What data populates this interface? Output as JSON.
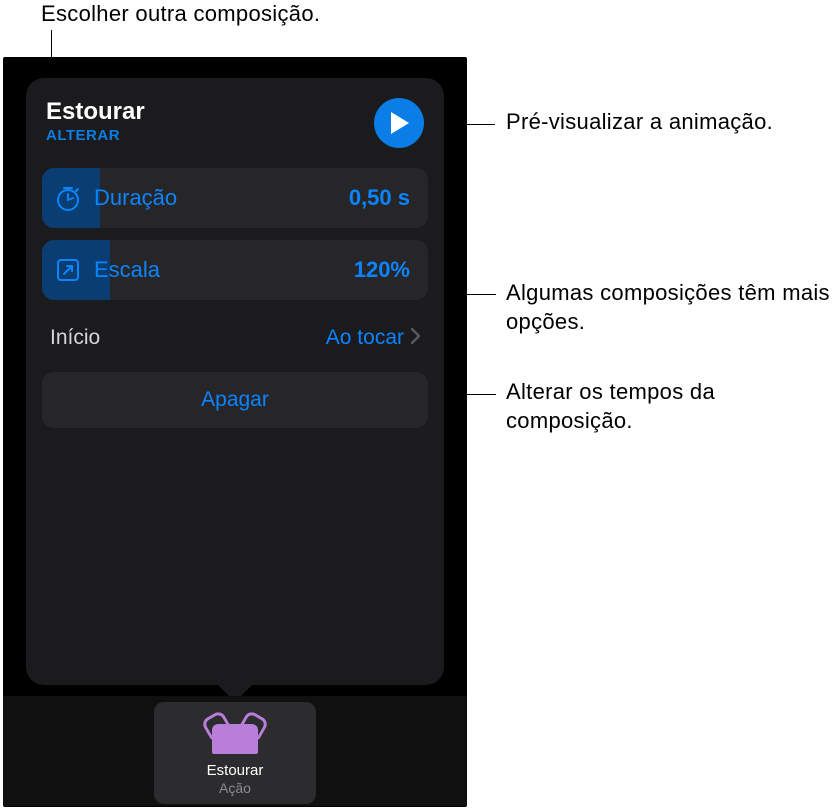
{
  "callouts": {
    "choose_another": "Escolher outra composição.",
    "preview": "Pré-visualizar a animação.",
    "more_options": "Algumas composições têm mais opções.",
    "timing": "Alterar os tempos da composição."
  },
  "popover": {
    "title": "Estourar",
    "change": "ALTERAR",
    "duration": {
      "label": "Duração",
      "value": "0,50 s"
    },
    "scale": {
      "label": "Escala",
      "value": "120%"
    },
    "start": {
      "label": "Início",
      "value": "Ao tocar"
    },
    "delete": "Apagar"
  },
  "thumb": {
    "title": "Estourar",
    "subtitle": "Ação"
  },
  "colors": {
    "accent": "#0a84ff"
  }
}
